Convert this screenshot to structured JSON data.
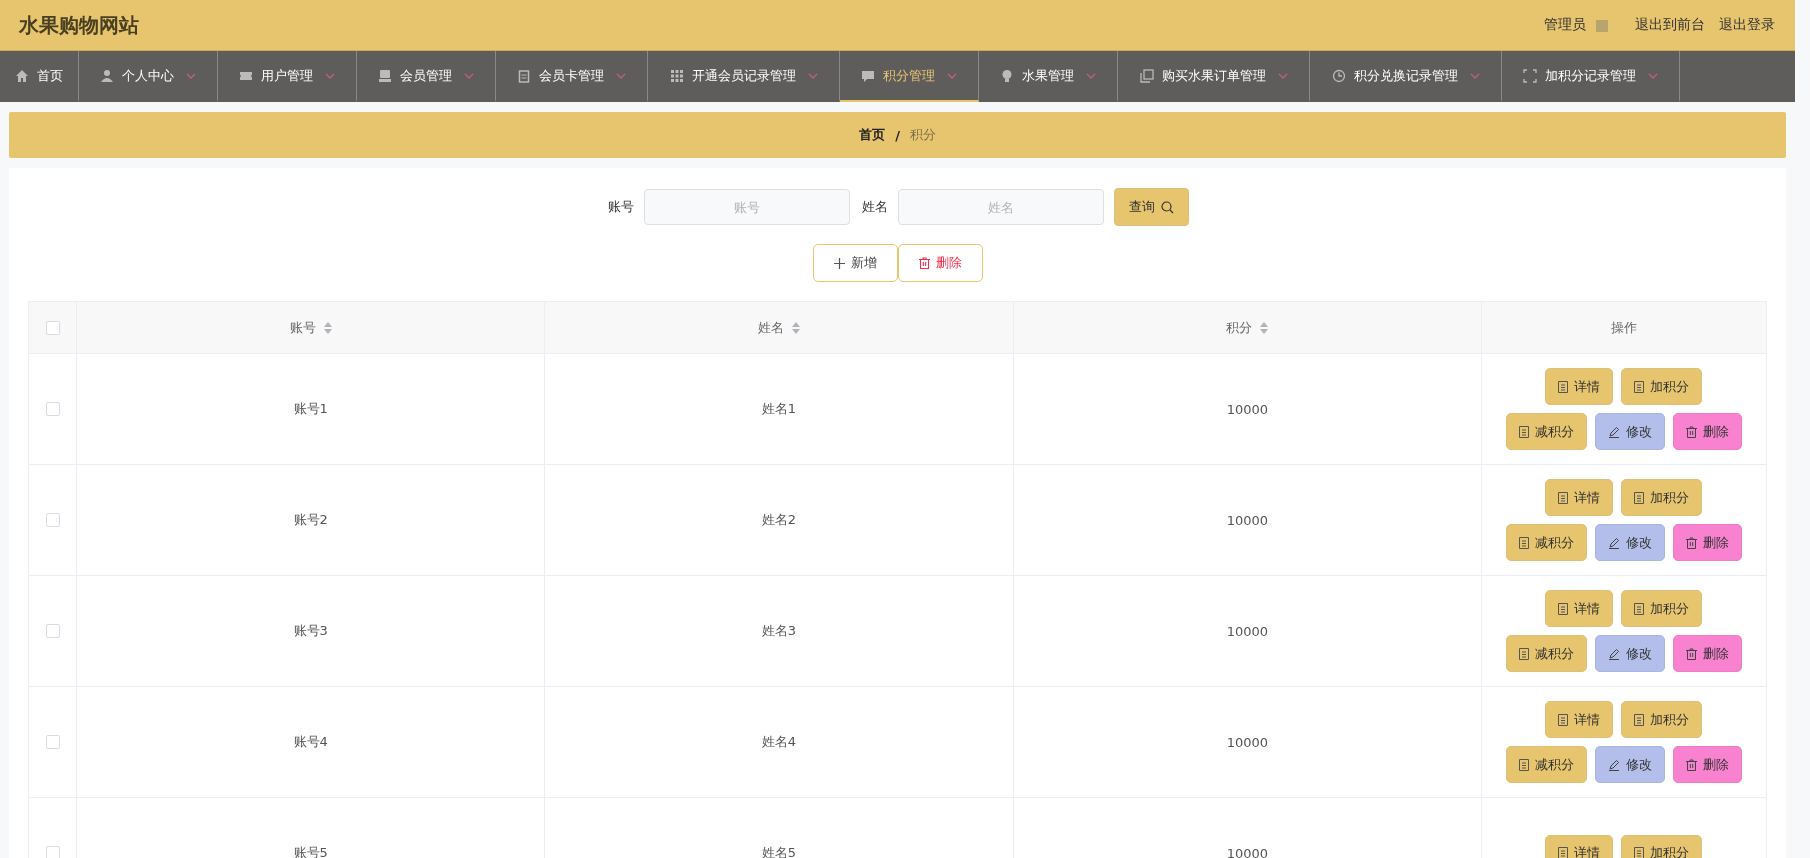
{
  "header": {
    "title": "水果购物网站",
    "user": "管理员",
    "links": [
      "退出到前台",
      "退出登录"
    ]
  },
  "nav": [
    {
      "label": "首页",
      "dropdown": false,
      "selected": false
    },
    {
      "label": "个人中心",
      "dropdown": true,
      "selected": false
    },
    {
      "label": "用户管理",
      "dropdown": true,
      "selected": false
    },
    {
      "label": "会员管理",
      "dropdown": true,
      "selected": false
    },
    {
      "label": "会员卡管理",
      "dropdown": true,
      "selected": false
    },
    {
      "label": "开通会员记录管理",
      "dropdown": true,
      "selected": false
    },
    {
      "label": "积分管理",
      "dropdown": true,
      "selected": true
    },
    {
      "label": "水果管理",
      "dropdown": true,
      "selected": false
    },
    {
      "label": "购买水果订单管理",
      "dropdown": true,
      "selected": false
    },
    {
      "label": "积分兑换记录管理",
      "dropdown": true,
      "selected": false
    },
    {
      "label": "加积分记录管理",
      "dropdown": true,
      "selected": false
    }
  ],
  "breadcrumb": {
    "separator": "/",
    "items": [
      "首页",
      "积分"
    ]
  },
  "search": {
    "fields": [
      {
        "label": "账号",
        "placeholder": "账号"
      },
      {
        "label": "姓名",
        "placeholder": "姓名"
      }
    ],
    "button": "查询"
  },
  "actions": [
    {
      "kind": "add",
      "label": "新增"
    },
    {
      "kind": "delete",
      "label": "删除"
    }
  ],
  "table": {
    "all_checked": false,
    "columns": [
      {
        "label": "账号",
        "sortable": true
      },
      {
        "label": "姓名",
        "sortable": true
      },
      {
        "label": "积分",
        "sortable": true
      },
      {
        "label": "操作",
        "sortable": false
      }
    ],
    "rows": [
      {
        "checked": false,
        "cells": [
          "账号1",
          "姓名1",
          "10000"
        ],
        "buttons": [
          {
            "kind": "detail",
            "label": "详情"
          },
          {
            "kind": "plus",
            "label": "加积分"
          },
          {
            "kind": "minus",
            "label": "减积分"
          },
          {
            "kind": "edit",
            "label": "修改"
          },
          {
            "kind": "delete",
            "label": "删除"
          }
        ]
      },
      {
        "checked": false,
        "cells": [
          "账号2",
          "姓名2",
          "10000"
        ],
        "buttons": [
          {
            "kind": "detail",
            "label": "详情"
          },
          {
            "kind": "plus",
            "label": "加积分"
          },
          {
            "kind": "minus",
            "label": "减积分"
          },
          {
            "kind": "edit",
            "label": "修改"
          },
          {
            "kind": "delete",
            "label": "删除"
          }
        ]
      },
      {
        "checked": false,
        "cells": [
          "账号3",
          "姓名3",
          "10000"
        ],
        "buttons": [
          {
            "kind": "detail",
            "label": "详情"
          },
          {
            "kind": "plus",
            "label": "加积分"
          },
          {
            "kind": "minus",
            "label": "减积分"
          },
          {
            "kind": "edit",
            "label": "修改"
          },
          {
            "kind": "delete",
            "label": "删除"
          }
        ]
      },
      {
        "checked": false,
        "cells": [
          "账号4",
          "姓名4",
          "10000"
        ],
        "buttons": [
          {
            "kind": "detail",
            "label": "详情"
          },
          {
            "kind": "plus",
            "label": "加积分"
          },
          {
            "kind": "minus",
            "label": "减积分"
          },
          {
            "kind": "edit",
            "label": "修改"
          },
          {
            "kind": "delete",
            "label": "删除"
          }
        ]
      },
      {
        "checked": false,
        "cells": [
          "账号5",
          "姓名5",
          "10000"
        ],
        "buttons": [
          {
            "kind": "detail",
            "label": "详情"
          },
          {
            "kind": "plus",
            "label": "加积分"
          }
        ]
      }
    ]
  }
}
